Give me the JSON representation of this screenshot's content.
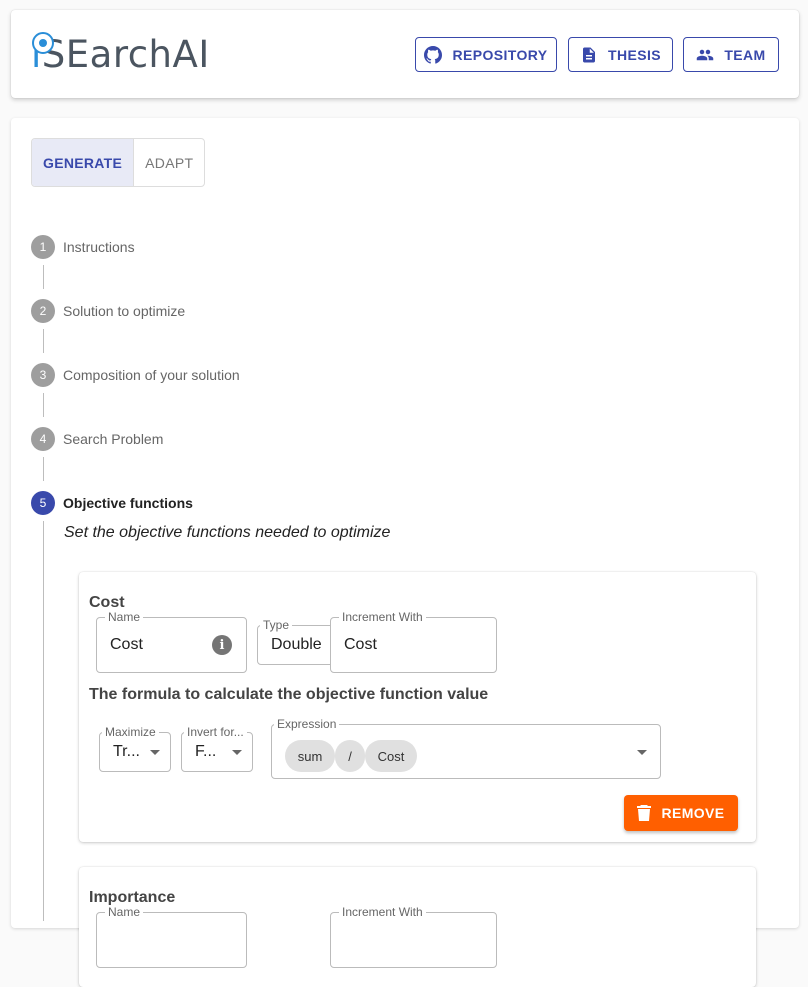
{
  "header": {
    "logo_prefix": "i",
    "logo_rest": "SEarchAI",
    "buttons": [
      {
        "label": "REPOSITORY",
        "icon": "github-icon"
      },
      {
        "label": "THESIS",
        "icon": "document-icon"
      },
      {
        "label": "TEAM",
        "icon": "people-icon"
      }
    ]
  },
  "mode_toggle": {
    "options": [
      "GENERATE",
      "ADAPT"
    ],
    "selected": "GENERATE"
  },
  "stepper": {
    "steps": [
      {
        "number": "1",
        "label": "Instructions"
      },
      {
        "number": "2",
        "label": "Solution to optimize"
      },
      {
        "number": "3",
        "label": "Composition of your solution"
      },
      {
        "number": "4",
        "label": "Search Problem"
      },
      {
        "number": "5",
        "label": "Objective functions"
      }
    ],
    "active_step": 5,
    "active_description": "Set the objective functions needed to optimize"
  },
  "objectives": [
    {
      "title": "Cost",
      "name_label": "Name",
      "name_value": "Cost",
      "type_label": "Type",
      "type_value": "Double",
      "increment_label": "Increment With",
      "increment_value": "Cost",
      "formula_title": "The formula to calculate the objective function value",
      "maximize_label": "Maximize",
      "maximize_value": "Tr...",
      "invert_label": "Invert for...",
      "invert_value": "F...",
      "expression_label": "Expression",
      "expression_chips": [
        "sum",
        "/",
        "Cost"
      ],
      "remove_label": "REMOVE"
    },
    {
      "title": "Importance",
      "name_label": "Name",
      "increment_label": "Increment With"
    }
  ],
  "colors": {
    "primary": "#3949ab",
    "remove": "#ff5f00",
    "logo_accent": "#2a8ed8"
  }
}
